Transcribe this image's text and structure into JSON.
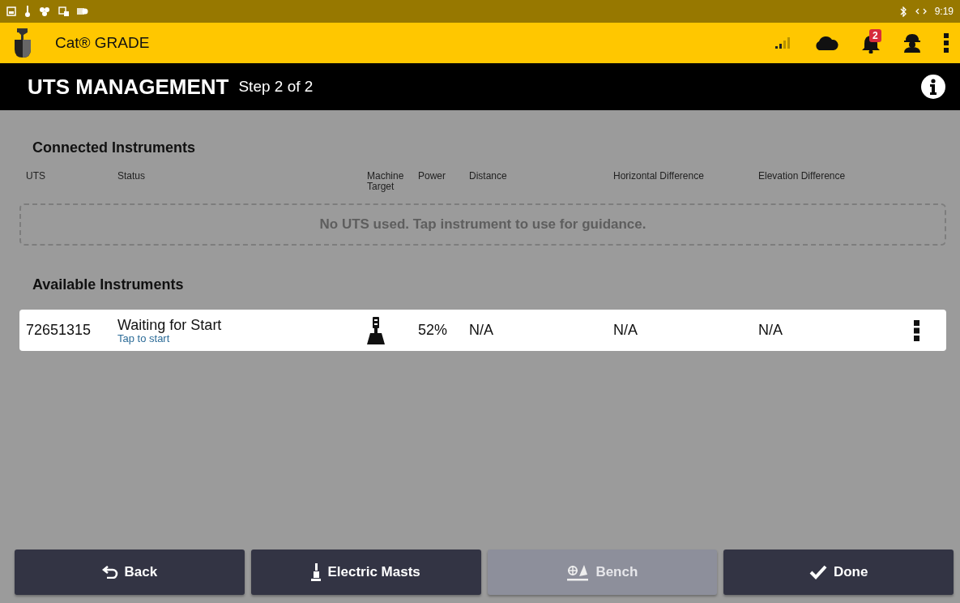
{
  "status_bar": {
    "time": "9:19"
  },
  "app_bar": {
    "title": "Cat® GRADE",
    "notification_count": "2"
  },
  "title_bar": {
    "title": "UTS MANAGEMENT",
    "step": "Step 2 of 2"
  },
  "connected": {
    "heading": "Connected Instruments",
    "columns": [
      "UTS",
      "Status",
      "Machine Target",
      "Power",
      "Distance",
      "Horizontal Difference",
      "Elevation Difference"
    ],
    "empty_message": "No UTS used. Tap instrument to use for guidance."
  },
  "available": {
    "heading": "Available Instruments",
    "rows": [
      {
        "uts": "72651315",
        "status": "Waiting for Start",
        "action": "Tap to start",
        "power": "52%",
        "distance": "N/A",
        "horizontal_difference": "N/A",
        "elevation_difference": "N/A"
      }
    ]
  },
  "buttons": [
    {
      "kind": "back",
      "label": "Back",
      "disabled": false
    },
    {
      "kind": "masts",
      "label": "Electric Masts",
      "disabled": false
    },
    {
      "kind": "bench",
      "label": "Bench",
      "disabled": true
    },
    {
      "kind": "done",
      "label": "Done",
      "disabled": false
    }
  ]
}
